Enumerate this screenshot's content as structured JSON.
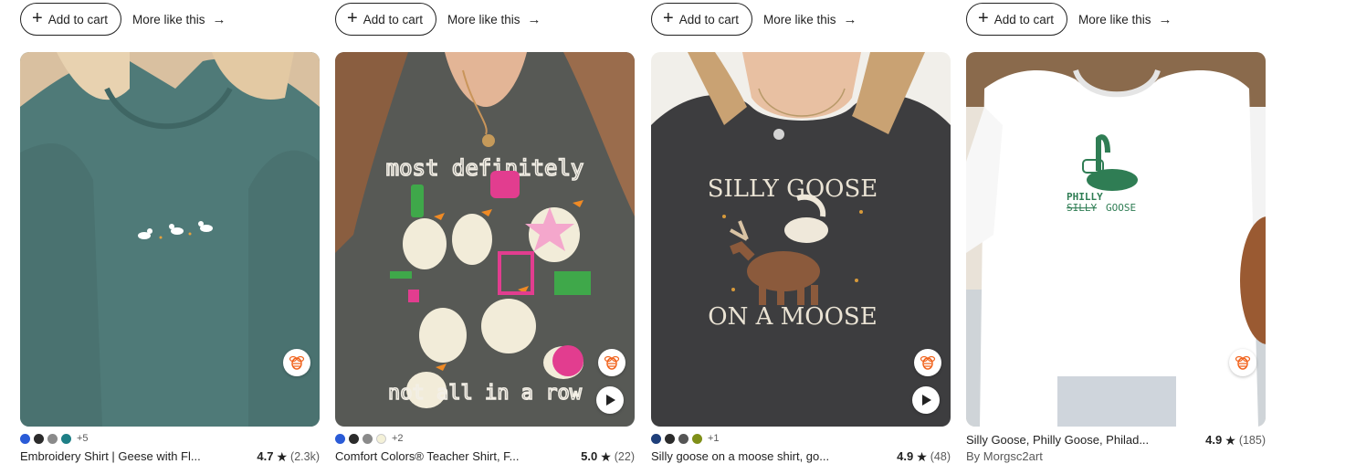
{
  "listings": [
    {
      "add_to_cart": "Add to cart",
      "more_like_this": "More like this",
      "swatches": [
        "#2a5bd7",
        "#2b2b2b",
        "#8a8a8a",
        "#1e7f86"
      ],
      "more_colors": "+5",
      "title": "Embroidery Shirt | Geese with Fl...",
      "rating": "4.7",
      "reviews": "(2.3k)",
      "has_video": false,
      "bg": "#4e7876"
    },
    {
      "add_to_cart": "Add to cart",
      "more_like_this": "More like this",
      "swatches": [
        "#2a5bd7",
        "#2b2b2b",
        "#8a8a8a",
        "#f4f1d8"
      ],
      "more_colors": "+2",
      "title": "Comfort Colors® Teacher Shirt, F...",
      "rating": "5.0",
      "reviews": "(22)",
      "has_video": true,
      "shirt_text_top": "most definitely",
      "shirt_text_bottom": "not all in a row",
      "bg": "#565854"
    },
    {
      "add_to_cart": "Add to cart",
      "more_like_this": "More like this",
      "swatches": [
        "#1f3f7a",
        "#2b2b2b",
        "#555555",
        "#7f8f18"
      ],
      "more_colors": "+1",
      "title": "Silly goose on a moose shirt, go...",
      "rating": "4.9",
      "reviews": "(48)",
      "has_video": true,
      "shirt_text_top": "SILLY GOOSE",
      "shirt_text_bottom": "ON A MOOSE",
      "bg": "#3c3c3e"
    },
    {
      "add_to_cart": "Add to cart",
      "more_like_this": "More like this",
      "title": "Silly Goose, Philly Goose, Philad...",
      "rating": "4.9",
      "reviews": "(185)",
      "seller": "By Morgsc2art",
      "has_video": false,
      "shirt_text_philly": "PHILLY",
      "shirt_text_silly": "SILLY",
      "shirt_text_goose": "GOOSE",
      "bg": "#f4f4f4"
    }
  ],
  "icons": {
    "plus": "plus-icon",
    "arrow": "arrow-right-icon",
    "star": "star-icon",
    "bee": "etsy-star-seller-bee-icon",
    "play": "play-icon"
  }
}
